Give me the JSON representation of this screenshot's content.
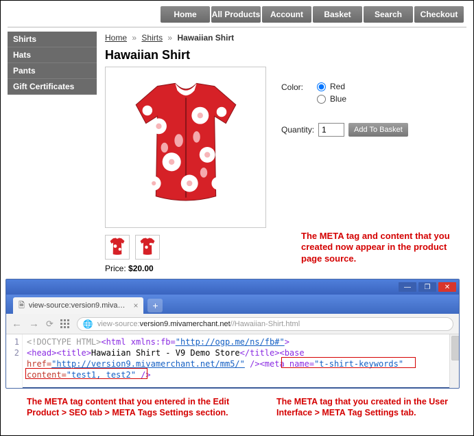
{
  "nav": {
    "items": [
      "Home",
      "All Products",
      "Account",
      "Basket",
      "Search",
      "Checkout"
    ]
  },
  "sidebar": {
    "items": [
      "Shirts",
      "Hats",
      "Pants",
      "Gift Certificates"
    ]
  },
  "breadcrumb": {
    "home": "Home",
    "cat": "Shirts",
    "current": "Hawaiian Shirt",
    "sep": "»"
  },
  "product": {
    "title": "Hawaiian Shirt",
    "color_label": "Color:",
    "colors": [
      {
        "label": "Red",
        "checked": true
      },
      {
        "label": "Blue",
        "checked": false
      }
    ],
    "qty_label": "Quantity:",
    "qty_value": "1",
    "addbtn": "Add To Basket",
    "price_label": "Price: ",
    "price_value": "$20.00"
  },
  "callouts": {
    "c1": "The META tag and content that you created now appear in the product page source.",
    "c2": "The META tag content that you entered in the Edit Product > SEO tab > META Tags Settings section.",
    "c3": "The META tag that you created in the User Interface > META Tag Settings tab."
  },
  "browser": {
    "tab_title": "view-source:version9.miva…",
    "url_gray_pre": "view-source:",
    "url_dark": "version9.mivamerchant.net",
    "url_gray_post": "//Hawaiian-Shirt.html",
    "lines": [
      "1",
      "2"
    ],
    "src": {
      "doctype": "<!DOCTYPE HTML>",
      "html_open": "<html xmlns:fb=",
      "html_ns": "\"http://ogp.me/ns/fb#\"",
      "html_close": ">",
      "head_open": "<head><title>",
      "title_text": "Hawaiian Shirt - V9 Demo Store",
      "title_close": "</title><base ",
      "href_attr": "href=",
      "href_val": "\"http://version9.mivamerchant.net/mm5/\"",
      "base_end": " />",
      "meta_open": "<meta name=",
      "meta_name": "\"t-shirt-keywords\"",
      "content_attr": "content=",
      "content_val": "\"test1, test2\"",
      "meta_end": " />"
    }
  }
}
